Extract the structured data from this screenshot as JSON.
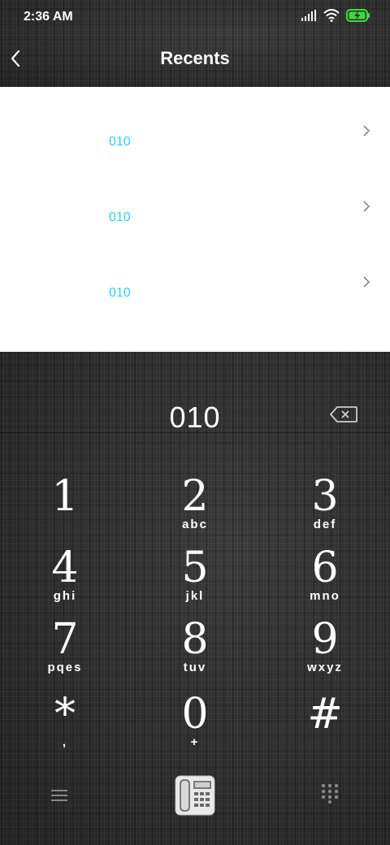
{
  "status": {
    "time": "2:36 AM"
  },
  "header": {
    "title": "Recents"
  },
  "recents": [
    {
      "number": "010"
    },
    {
      "number": "010"
    },
    {
      "number": "010"
    },
    {
      "number": ""
    }
  ],
  "dialer": {
    "display": "010",
    "keys": [
      {
        "digit": "1",
        "letters": ""
      },
      {
        "digit": "2",
        "letters": "abc"
      },
      {
        "digit": "3",
        "letters": "def"
      },
      {
        "digit": "4",
        "letters": "ghi"
      },
      {
        "digit": "5",
        "letters": "jkl"
      },
      {
        "digit": "6",
        "letters": "mno"
      },
      {
        "digit": "7",
        "letters": "pqes"
      },
      {
        "digit": "8",
        "letters": "tuv"
      },
      {
        "digit": "9",
        "letters": "wxyz"
      },
      {
        "digit": "*",
        "letters": ","
      },
      {
        "digit": "0",
        "letters": "+"
      },
      {
        "digit": "#",
        "letters": ""
      }
    ]
  },
  "icons": {
    "signal": "signal-icon",
    "wifi": "wifi-icon",
    "battery": "battery-charging-icon",
    "back": "back-arrow-icon",
    "chevron": "chevron-right-icon",
    "backspace": "backspace-icon",
    "menu": "menu-icon",
    "call": "telephone-icon",
    "keypad": "keypad-icon"
  },
  "colors": {
    "accent": "#2ad1f0",
    "battery": "#3ddc3d"
  }
}
